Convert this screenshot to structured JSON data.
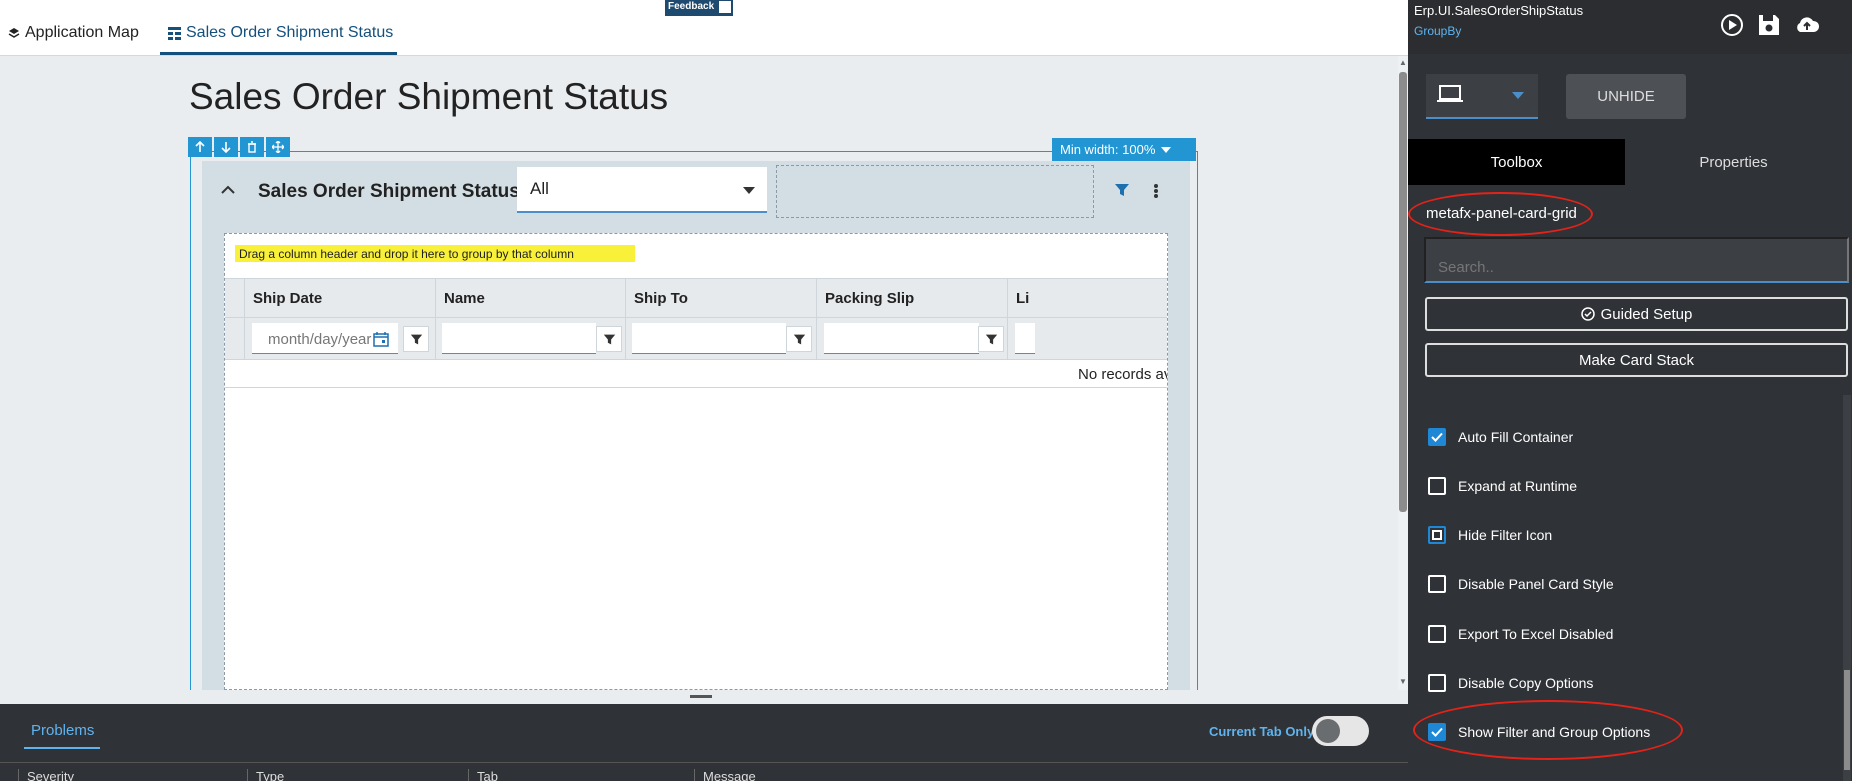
{
  "top_tabs": {
    "app_map": "Application Map",
    "sales_order": "Sales Order Shipment Status"
  },
  "feedback": "Feedback",
  "page": {
    "title": "Sales Order Shipment Status",
    "min_width": "Min width: 100%"
  },
  "card": {
    "title": "Sales Order Shipment Status",
    "dropdown_value": "All"
  },
  "grid": {
    "group_hint": "Drag a column header and drop it here to group by that column",
    "columns": [
      "Ship Date",
      "Name",
      "Ship To",
      "Packing Slip",
      "Li"
    ],
    "date_placeholder": "month/day/year",
    "no_records": "No records av"
  },
  "problems_panel": {
    "tab": "Problems",
    "current_tab_only": "Current Tab Only",
    "columns": [
      "Severity",
      "Type",
      "Tab",
      "Message"
    ]
  },
  "right_panel": {
    "title": "Erp.UI.SalesOrderShipStatus",
    "subtitle": "GroupBy",
    "unhide": "UNHIDE",
    "tabs": [
      "Toolbox",
      "Properties"
    ],
    "component_name": "metafx-panel-card-grid",
    "search_placeholder": "Search..",
    "guided_setup": "Guided Setup",
    "make_card_stack": "Make Card Stack",
    "options": [
      {
        "label": "Auto Fill Container",
        "checked": true
      },
      {
        "label": "Expand at Runtime",
        "checked": false
      },
      {
        "label": "Hide Filter Icon",
        "checked": "partial"
      },
      {
        "label": "Disable Panel Card Style",
        "checked": false
      },
      {
        "label": "Export To Excel Disabled",
        "checked": false
      },
      {
        "label": "Disable Copy Options",
        "checked": false
      },
      {
        "label": "Show Filter and Group Options",
        "checked": true
      }
    ]
  },
  "colors": {
    "accent_blue": "#2196d3",
    "link_blue": "#5fb4f0",
    "highlight_yellow": "#f9f03a",
    "annotation_red": "#e2231a",
    "panel_dark": "#2f3236"
  }
}
